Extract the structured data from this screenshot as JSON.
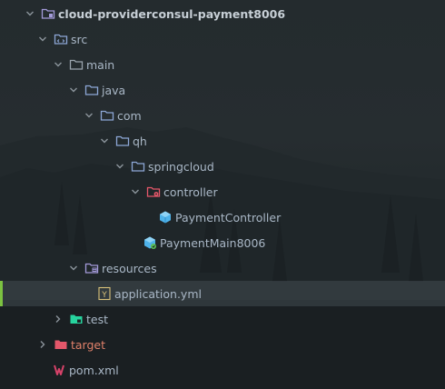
{
  "colors": {
    "text": "#a9b7c6",
    "root_text": "#c7cfd6",
    "excluded_text": "#e0816a",
    "folder": "#8da7d6",
    "module_folder": "#a39ad9",
    "test_folder": "#27d39e",
    "target_folder": "#e4576a",
    "package_badge": "#e4576a",
    "class_icon": "#4fb3ea",
    "maven": "#d8426a",
    "yaml_icon": "#d9c27a",
    "selection_bar": "#7cc241"
  },
  "tree": {
    "nodes": [
      {
        "label": "cloud-providerconsul-payment8006",
        "icon": "module-folder-icon",
        "state": "expanded"
      },
      {
        "label": "src",
        "icon": "source-folder-icon",
        "state": "expanded"
      },
      {
        "label": "main",
        "icon": "folder-icon",
        "state": "expanded"
      },
      {
        "label": "java",
        "icon": "source-root-folder-icon",
        "state": "expanded"
      },
      {
        "label": "com",
        "icon": "folder-icon",
        "state": "expanded"
      },
      {
        "label": "qh",
        "icon": "folder-icon",
        "state": "expanded"
      },
      {
        "label": "springcloud",
        "icon": "folder-icon",
        "state": "expanded"
      },
      {
        "label": "controller",
        "icon": "package-folder-icon",
        "state": "expanded"
      },
      {
        "label": "PaymentController",
        "icon": "class-icon",
        "state": "leaf"
      },
      {
        "label": "PaymentMain8006",
        "icon": "spring-boot-class-icon",
        "state": "leaf"
      },
      {
        "label": "resources",
        "icon": "resources-folder-icon",
        "state": "expanded"
      },
      {
        "label": "application.yml",
        "icon": "yaml-file-icon",
        "state": "selected"
      },
      {
        "label": "test",
        "icon": "test-folder-icon",
        "state": "collapsed"
      },
      {
        "label": "target",
        "icon": "excluded-folder-icon",
        "state": "collapsed"
      },
      {
        "label": "pom.xml",
        "icon": "maven-icon",
        "state": "leaf"
      }
    ]
  }
}
